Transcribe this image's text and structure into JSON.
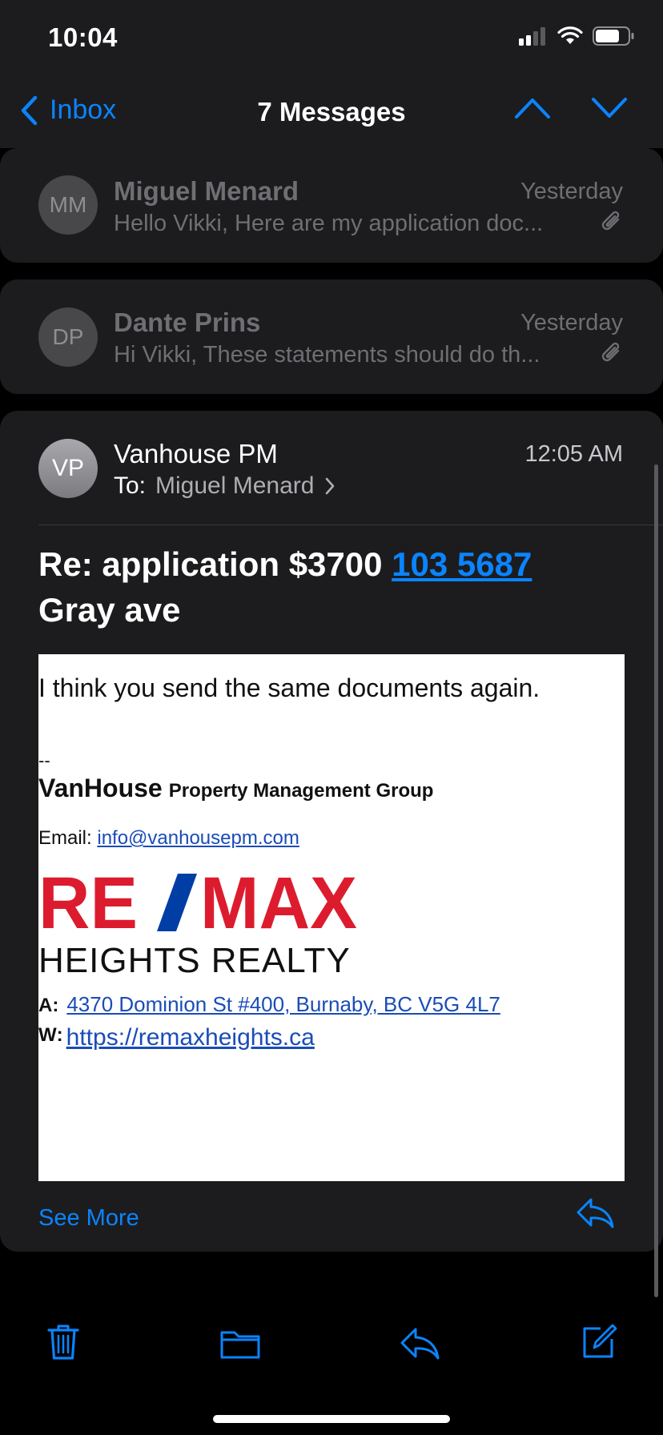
{
  "status_bar": {
    "time": "10:04"
  },
  "nav": {
    "back_label": "Inbox",
    "title": "7 Messages"
  },
  "messages": [
    {
      "initials": "MM",
      "sender": "Miguel Menard",
      "date": "Yesterday",
      "preview": "Hello Vikki, Here are my application doc..."
    },
    {
      "initials": "DP",
      "sender": "Dante Prins",
      "date": "Yesterday",
      "preview": "Hi Vikki, These statements should do th..."
    }
  ],
  "open_message": {
    "initials": "VP",
    "sender": "Vanhouse PM",
    "time": "12:05 AM",
    "to_label": "To:",
    "to_name": "Miguel Menard",
    "subject_prefix": "Re: application $3700 ",
    "subject_link": "103 5687",
    "subject_suffix": "Gray ave",
    "body": "I think you send the same documents again.",
    "signature": {
      "dashes": "--",
      "company_bold": "VanHouse",
      "company_rest": "Property Management Group",
      "email_label": "Email:",
      "email": "info@vanhousepm.com",
      "logo_text": "RE/MAX",
      "realty": "HEIGHTS REALTY",
      "address_label": "A",
      "address": "4370 Dominion St #400, Burnaby, BC V5G 4L7",
      "web_label": "W",
      "website": "https://remaxheights.ca"
    },
    "see_more": "See More"
  },
  "colors": {
    "accent": "#0a84ff",
    "remax_red": "#dc1c2e",
    "remax_blue": "#003da5"
  }
}
